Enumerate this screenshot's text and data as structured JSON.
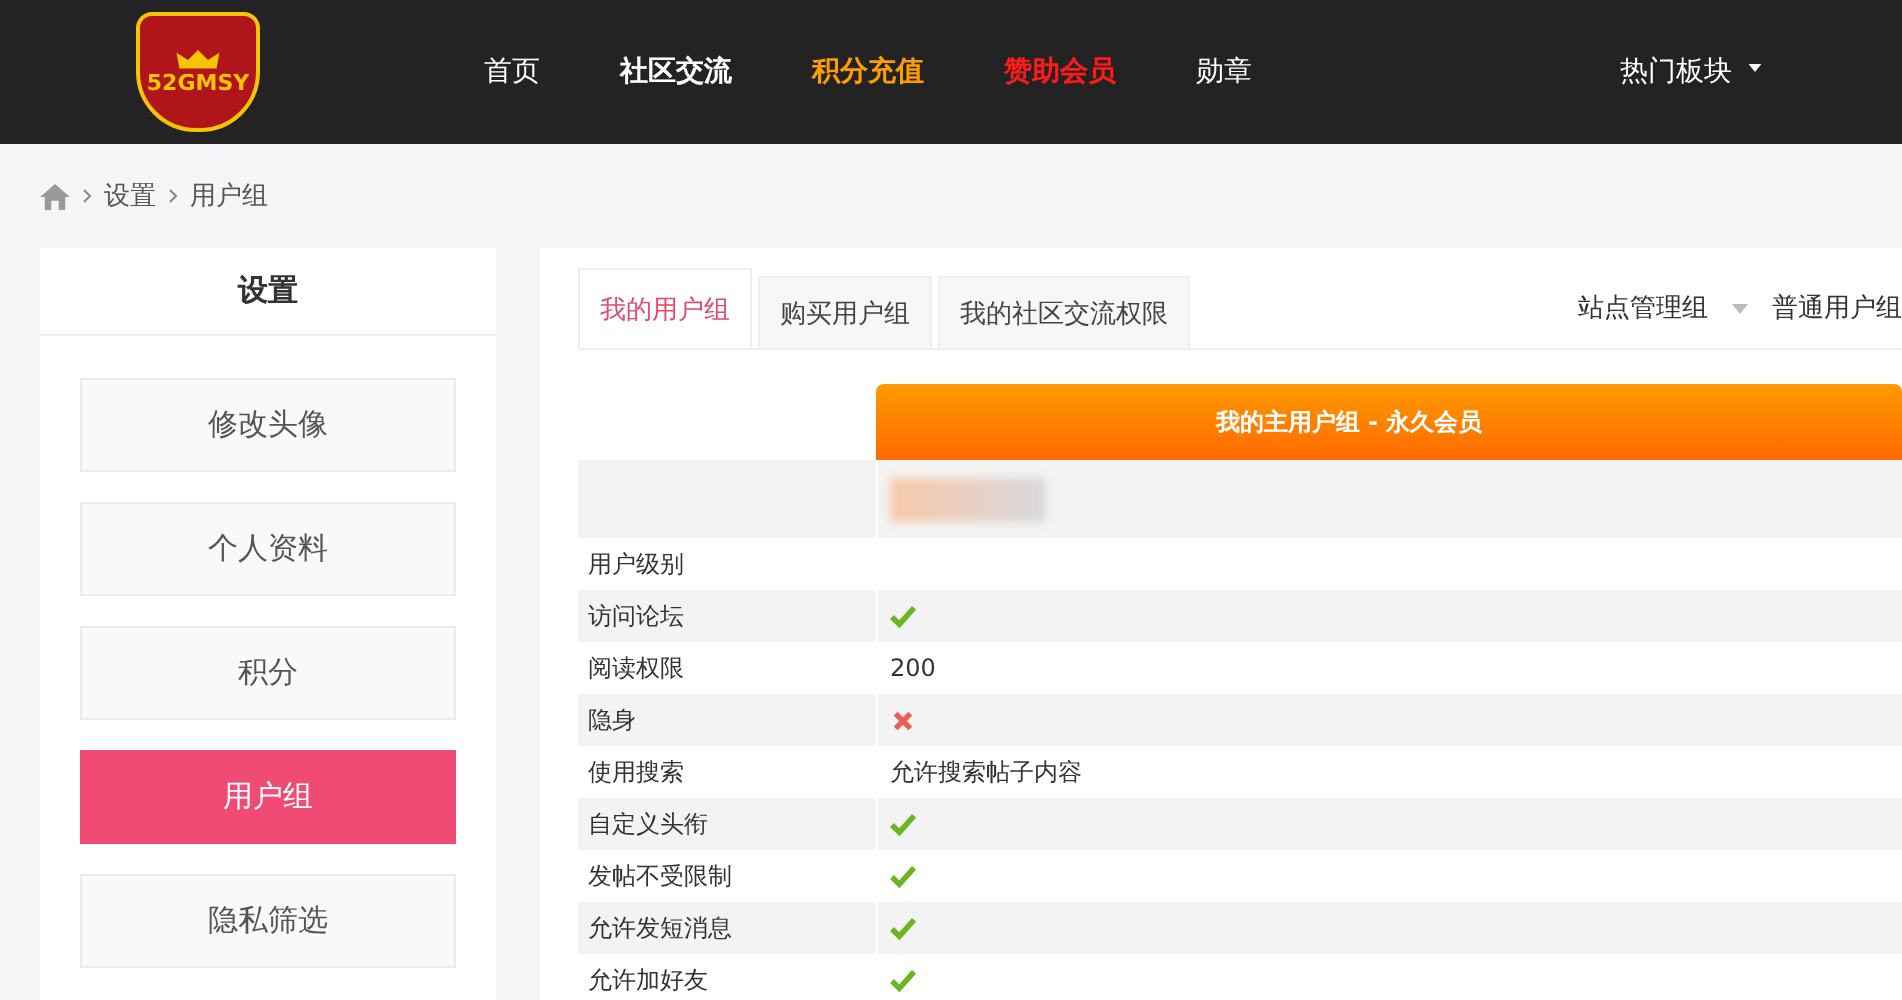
{
  "header": {
    "logo_text": "52GMSY",
    "nav": [
      {
        "label": "首页",
        "color": "#ffffff"
      },
      {
        "label": "社区交流",
        "color": "#ffffff"
      },
      {
        "label": "积分充值",
        "color": "#ff9c00"
      },
      {
        "label": "赞助会员",
        "color": "#ff1a1a"
      },
      {
        "label": "勋章",
        "color": "#ffffff"
      }
    ],
    "dropdown": "热门板块"
  },
  "breadcrumb": [
    "设置",
    "用户组"
  ],
  "sidebar": {
    "title": "设置",
    "items": [
      {
        "label": "修改头像",
        "selected": false
      },
      {
        "label": "个人资料",
        "selected": false
      },
      {
        "label": "积分",
        "selected": false
      },
      {
        "label": "用户组",
        "selected": true
      },
      {
        "label": "隐私筛选",
        "selected": false
      }
    ]
  },
  "tabs": [
    {
      "label": "我的用户组",
      "selected": true
    },
    {
      "label": "购买用户组",
      "selected": false
    },
    {
      "label": "我的社区交流权限",
      "selected": false
    }
  ],
  "group_filters": [
    {
      "label": "站点管理组",
      "dropdown": true
    },
    {
      "label": "普通用户组",
      "dropdown": false
    }
  ],
  "table": {
    "header": "我的主用户组 - 永久会员",
    "rows": [
      {
        "label": "用户级别",
        "kind": "empty"
      },
      {
        "label": "访问论坛",
        "kind": "check"
      },
      {
        "label": "阅读权限",
        "kind": "text",
        "value": "200"
      },
      {
        "label": "隐身",
        "kind": "cross"
      },
      {
        "label": "使用搜索",
        "kind": "text",
        "value": "允许搜索帖子内容"
      },
      {
        "label": "自定义头衔",
        "kind": "check"
      },
      {
        "label": "发帖不受限制",
        "kind": "check"
      },
      {
        "label": "允许发短消息",
        "kind": "check"
      },
      {
        "label": "允许加好友",
        "kind": "check"
      }
    ]
  }
}
